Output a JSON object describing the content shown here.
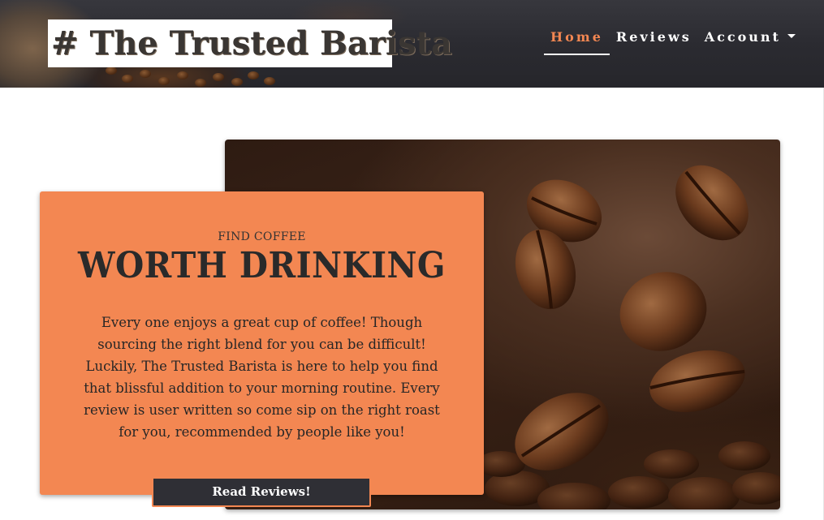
{
  "header": {
    "logo_text": "# The Trusted Barista",
    "nav": [
      {
        "label": "Home",
        "active": true
      },
      {
        "label": "Reviews",
        "active": false
      },
      {
        "label": "Account",
        "active": false,
        "dropdown": true
      }
    ]
  },
  "hero": {
    "eyebrow": "FIND COFFEE",
    "headline": "WORTH DRINKING",
    "body": "Every one enjoys a great cup of coffee! Though sourcing the right blend for you can be difficult! Luckily, The Trusted Barista is here to help you find that blissful addition to your morning routine. Every review is user written so come sip on the right roast for you, recommended by people like you!",
    "cta_label": "Read Reviews!"
  },
  "colors": {
    "accent": "#f38752",
    "header_dark": "#2b2b31",
    "button_dark": "#2f2f35"
  },
  "icons": {
    "dropdown": "caret-down-icon"
  }
}
